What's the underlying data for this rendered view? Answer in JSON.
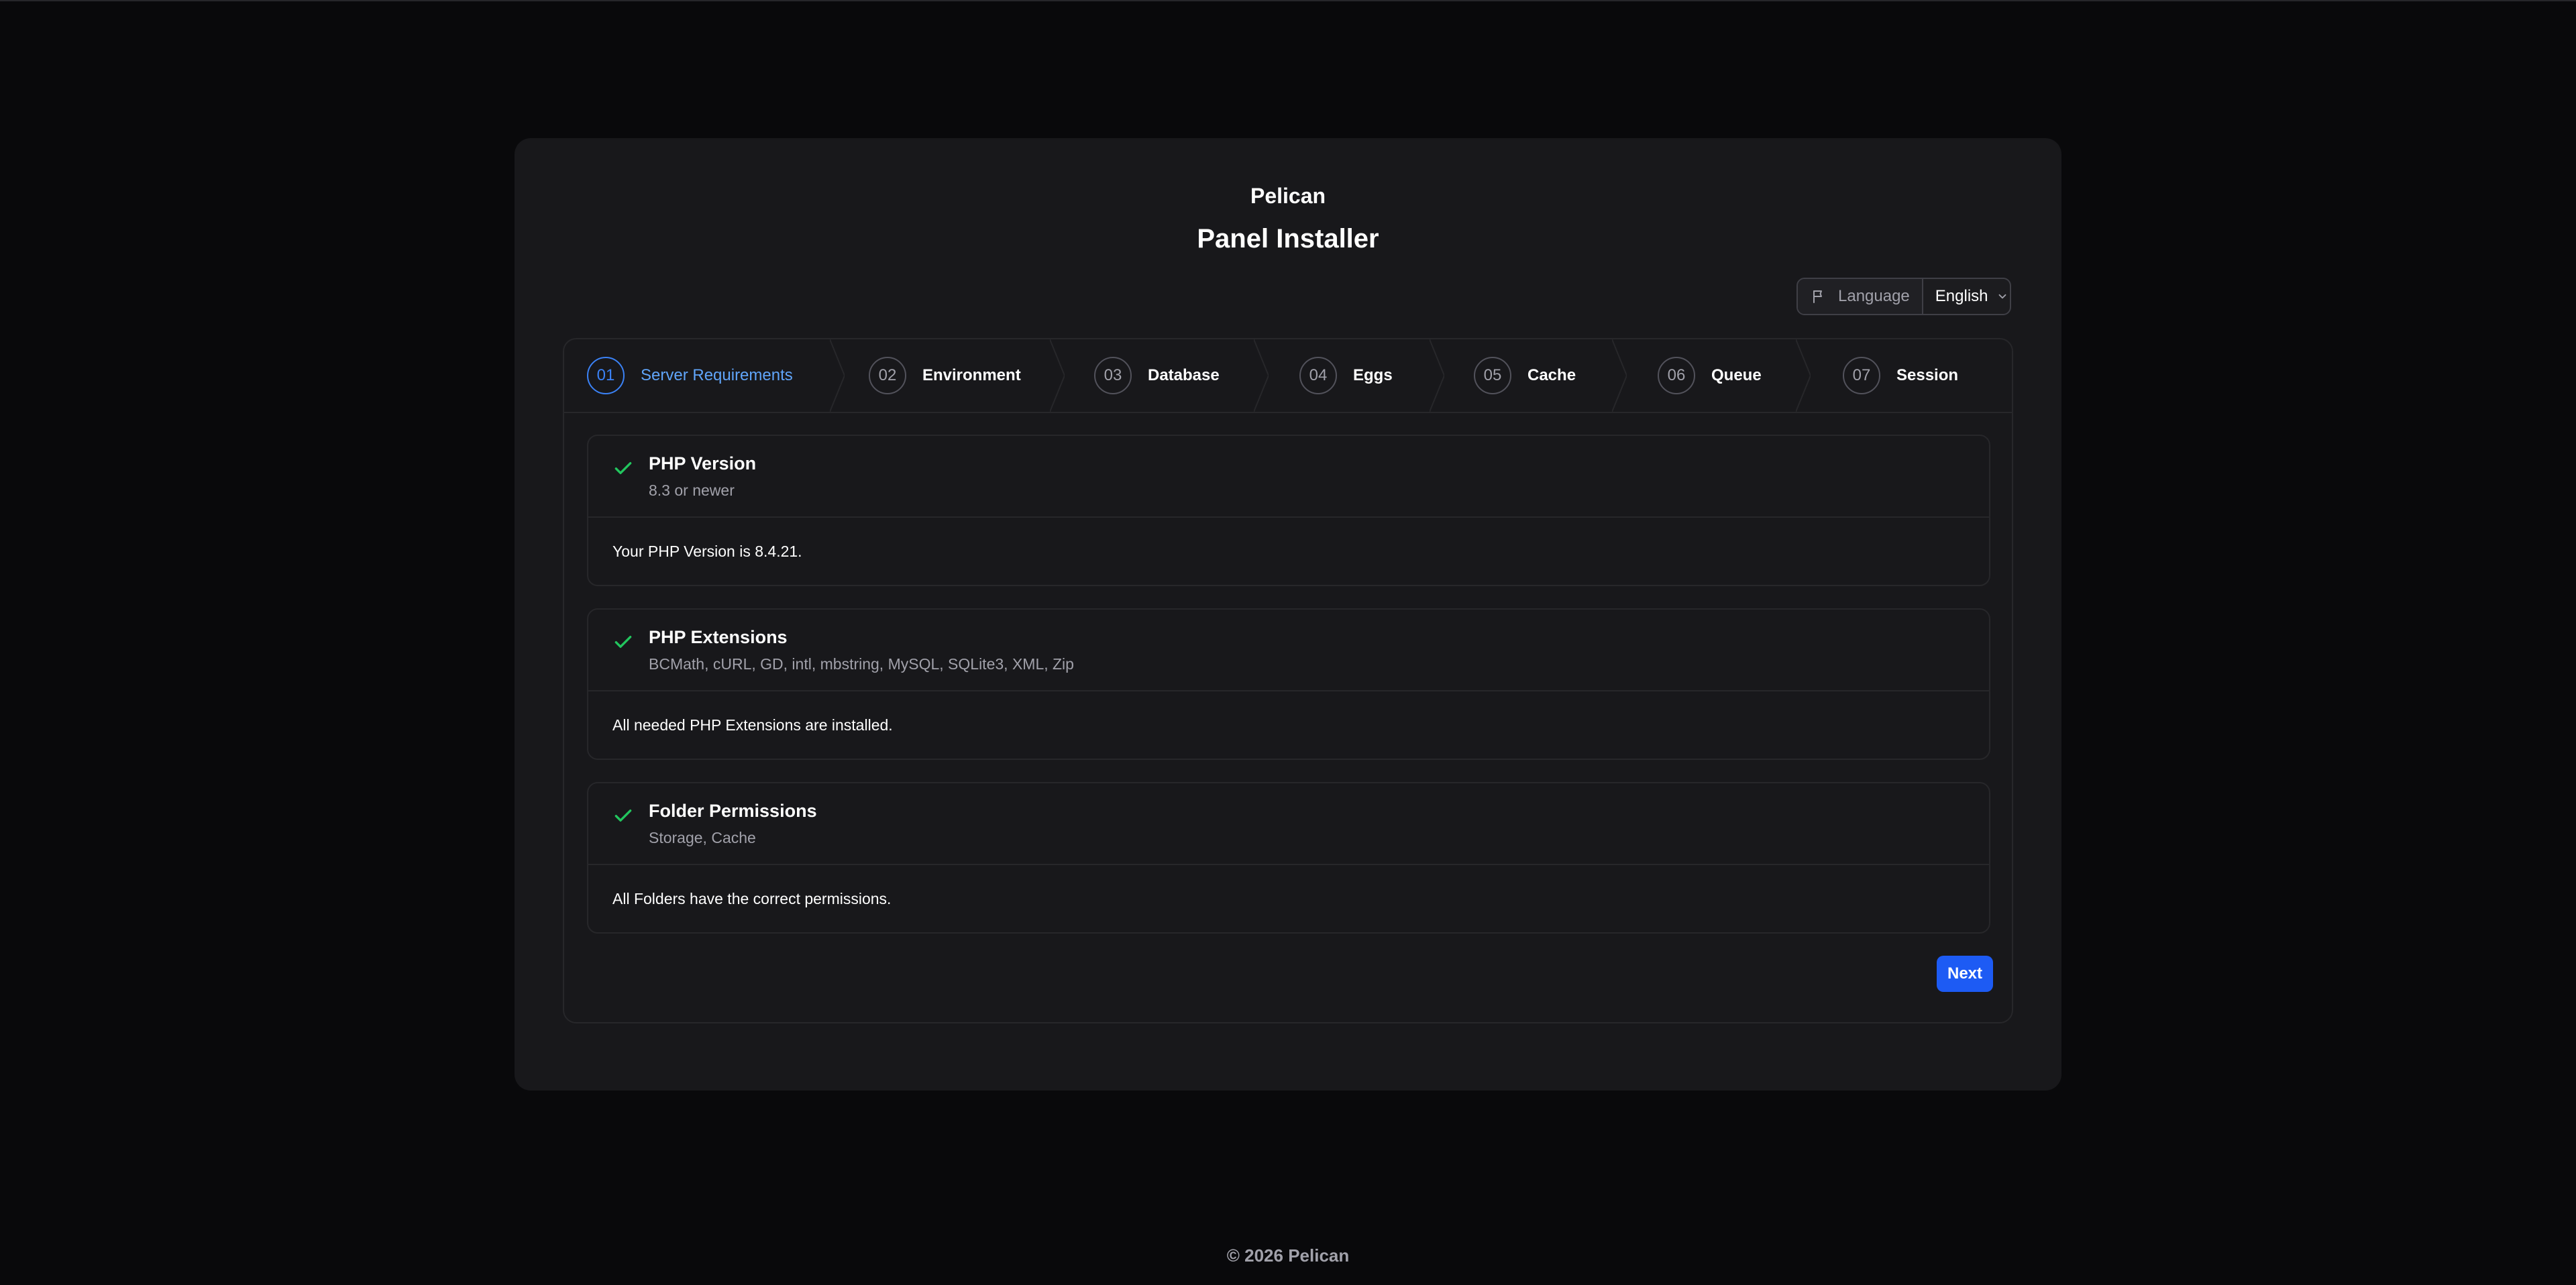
{
  "header": {
    "brand": "Pelican",
    "title": "Panel Installer"
  },
  "language": {
    "label": "Language",
    "selected": "English",
    "icon": "flag-icon"
  },
  "steps": [
    {
      "num": "01",
      "label": "Server Requirements",
      "active": true
    },
    {
      "num": "02",
      "label": "Environment"
    },
    {
      "num": "03",
      "label": "Database"
    },
    {
      "num": "04",
      "label": "Eggs"
    },
    {
      "num": "05",
      "label": "Cache"
    },
    {
      "num": "06",
      "label": "Queue"
    },
    {
      "num": "07",
      "label": "Session"
    }
  ],
  "sections": [
    {
      "title": "PHP Version",
      "description": "8.3 or newer",
      "message": "Your PHP Version is 8.4.21.",
      "status": "passed"
    },
    {
      "title": "PHP Extensions",
      "description": "BCMath, cURL, GD, intl, mbstring, MySQL, SQLite3, XML, Zip",
      "message": "All needed PHP Extensions are installed.",
      "status": "passed"
    },
    {
      "title": "Folder Permissions",
      "description": "Storage, Cache",
      "message": "All Folders have the correct permissions.",
      "status": "passed"
    }
  ],
  "actions": {
    "next_label": "Next"
  },
  "footer": {
    "text": "© 2026 Pelican"
  },
  "colors": {
    "accent": "#1d5bf4",
    "active_step": "#60a5fa",
    "success": "#22c55e",
    "background": "#09090b",
    "card": "#18181b"
  }
}
